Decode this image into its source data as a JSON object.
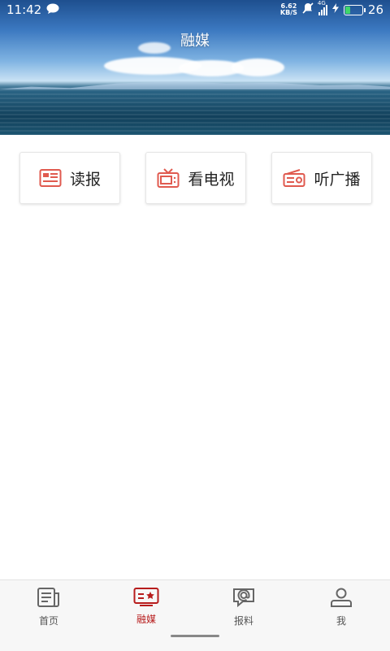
{
  "status_bar": {
    "time": "11:42",
    "speed_value": "6.62",
    "speed_unit": "KB/S",
    "network": "4G",
    "battery": "26",
    "battery_level": 0.26
  },
  "header": {
    "title": "融媒"
  },
  "cards": [
    {
      "label": "读报",
      "icon": "newspaper-icon"
    },
    {
      "label": "看电视",
      "icon": "tv-icon"
    },
    {
      "label": "听广播",
      "icon": "radio-icon"
    }
  ],
  "tabs": [
    {
      "label": "首页",
      "icon": "home-news-icon",
      "active": false
    },
    {
      "label": "融媒",
      "icon": "media-icon",
      "active": true
    },
    {
      "label": "报料",
      "icon": "report-icon",
      "active": false
    },
    {
      "label": "我",
      "icon": "profile-icon",
      "active": false
    }
  ],
  "colors": {
    "accent": "#b71c1c",
    "icon_red": "#e05a4f",
    "tab_inactive": "#555555"
  }
}
